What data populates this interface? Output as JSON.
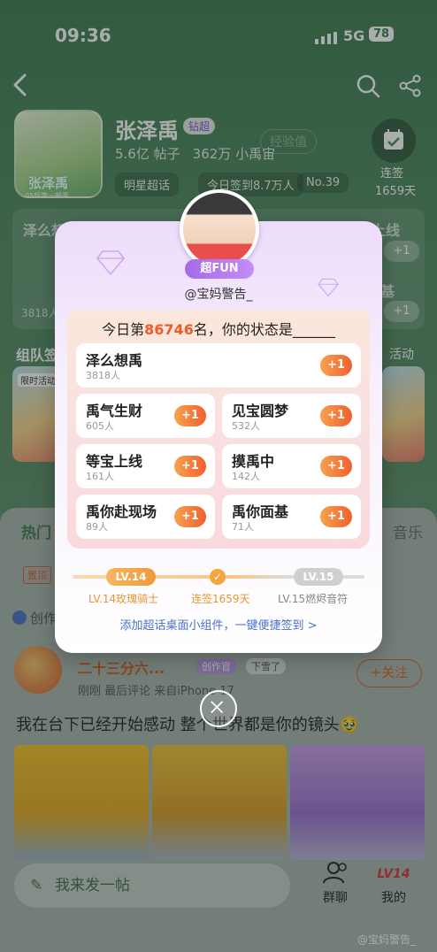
{
  "status_bar": {
    "time": "09:36",
    "network": "5G",
    "battery": "78"
  },
  "topic": {
    "name": "张泽禹",
    "tier_badge": "钻超",
    "avatar_caption": "张泽禹",
    "avatar_sub": "05后第一顿手",
    "exp_label": "经验值",
    "posts_count": "5.6亿",
    "posts_label": "帖子",
    "members_count": "362万",
    "members_label": "小禹宙",
    "tags": [
      "明星超话",
      "今日签到8.7万人",
      "No.39"
    ],
    "checkin_label": "连签",
    "checkin_days": "1659天"
  },
  "background": {
    "grid_items": [
      "泽么想禹",
      "等宝上线",
      "基"
    ],
    "grid_count": "3818人",
    "plus_label": "+1",
    "team_title": "组队签",
    "team_more": "活动",
    "team_card_tag": "限时活动"
  },
  "feed": {
    "tab_hot": "热门",
    "tab_music": "音乐",
    "top_tag": "置顶",
    "create_label": "创作",
    "post": {
      "username": "二十三分六...",
      "badge_creator": "创作官",
      "badge_snow": "下雪了",
      "follow_label": "+关注",
      "meta": "刚刚  最后评论  来自iPhone 17",
      "text": "我在台下已经开始感动 整个世界都是你的镜头🥹"
    },
    "compose_placeholder": "我来发一帖",
    "dock": {
      "group_chat": "群聊",
      "mine": "我的",
      "level_badge": "LV14"
    },
    "watermark": "@宝妈警告_"
  },
  "modal": {
    "badge": "超FUN",
    "username": "@宝妈警告_",
    "prompt_prefix": "今日第",
    "rank": "86746",
    "prompt_suffix": "名，你的状态是______",
    "options": [
      {
        "label": "泽么想禹",
        "count": "3818人"
      },
      {
        "label": "禹气生财",
        "count": "605人"
      },
      {
        "label": "见宝圆梦",
        "count": "532人"
      },
      {
        "label": "等宝上线",
        "count": "161人"
      },
      {
        "label": "摸禹中",
        "count": "142人"
      },
      {
        "label": "禹你赴现场",
        "count": "89人"
      },
      {
        "label": "禹你面基",
        "count": "71人"
      }
    ],
    "plus_label": "+1",
    "level_current": "LV.14",
    "level_next": "LV.15",
    "level_current_caption": "LV.14玫瑰骑士",
    "streak_caption": "连签1659天",
    "level_next_caption": "LV.15燃烬音符",
    "widget_link": "添加超话桌面小组件，一键便捷签到 >"
  },
  "colors": {
    "accent_orange": "#f1602f",
    "brand_green": "#3f7a52",
    "purple": "#a56ae8"
  }
}
